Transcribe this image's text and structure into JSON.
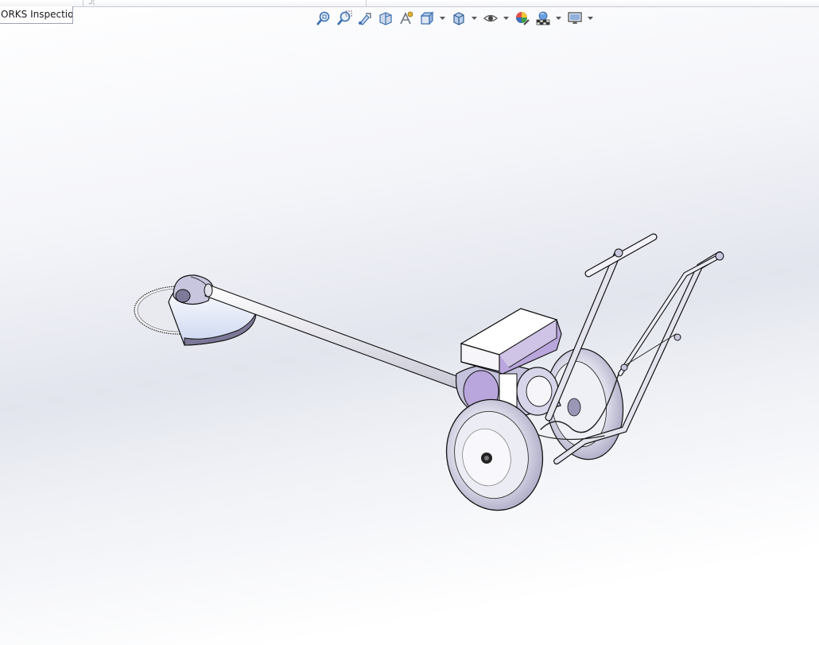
{
  "window": {
    "tab_label": "ORKS Inspection",
    "top_strip_segment": "Ͻ¦"
  },
  "heads_up_toolbar": {
    "items": [
      {
        "name": "zoom-to-fit-icon"
      },
      {
        "name": "zoom-to-area-icon"
      },
      {
        "name": "previous-view-icon"
      },
      {
        "name": "section-view-icon"
      },
      {
        "name": "dynamic-annotation-views-icon"
      },
      {
        "name": "view-orientation-icon",
        "dropdown": true
      },
      {
        "name": "display-style-icon",
        "dropdown": true
      },
      {
        "name": "hide-show-items-icon",
        "dropdown": true
      },
      {
        "name": "edit-appearance-icon"
      },
      {
        "name": "apply-scene-icon",
        "dropdown": true
      },
      {
        "name": "view-settings-icon",
        "dropdown": true
      }
    ],
    "colors": {
      "icon_blue": "#3a6fb0",
      "icon_gray": "#6b7280"
    }
  },
  "model": {
    "description_colors": {
      "edge": "#111111",
      "face_light": "#f7f7fb",
      "face_mid": "#d8d6ea",
      "face_dark": "#8f8ab0",
      "accent_purple": "#b9a6dc"
    }
  }
}
